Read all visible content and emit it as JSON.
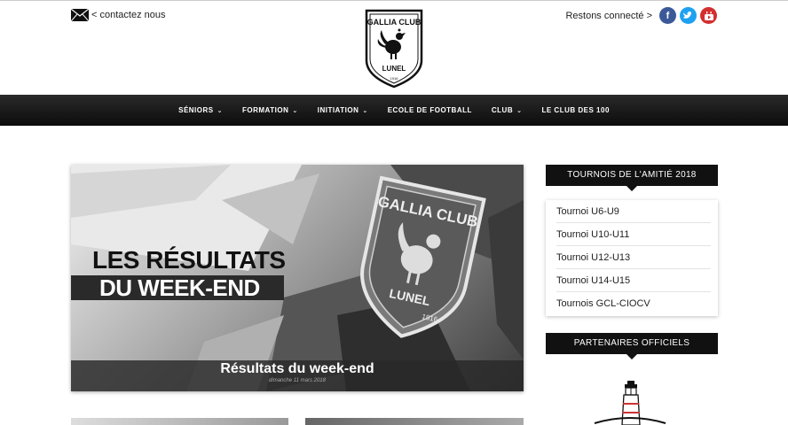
{
  "header": {
    "contact_label": "< contactez nous",
    "social_label": "Restons connecté >",
    "social": [
      {
        "name": "facebook",
        "glyph": "f",
        "color": "#3b5998"
      },
      {
        "name": "twitter",
        "glyph": "t",
        "color": "#1da1f2"
      },
      {
        "name": "youtube",
        "glyph": "▶",
        "color": "#d32f2f"
      }
    ],
    "logo": {
      "top_text": "GALLIA CLUB",
      "bottom_text": "LUNEL",
      "year": "1916"
    }
  },
  "nav": {
    "items": [
      {
        "label": "SÉNIORS",
        "has_dropdown": true
      },
      {
        "label": "FORMATION",
        "has_dropdown": true
      },
      {
        "label": "INITIATION",
        "has_dropdown": true
      },
      {
        "label": "ECOLE DE FOOTBALL",
        "has_dropdown": false
      },
      {
        "label": "CLUB",
        "has_dropdown": true
      },
      {
        "label": "LE CLUB DES 100",
        "has_dropdown": false
      }
    ]
  },
  "hero": {
    "image_line1": "LES RÉSULTATS",
    "image_line2": "DU WEEK-END",
    "badge_text": "GALLIA CLUB",
    "badge_bottom": "LUNEL",
    "badge_year": "1916",
    "title": "Résultats du week-end",
    "date": "dimanche 11 mars 2018"
  },
  "sidebar": {
    "tournois_title": "TOURNOIS DE L'AMITIÉ 2018",
    "tournois": [
      "Tournoi U6-U9",
      "Tournoi U10-U11",
      "Tournoi U12-U13",
      "Tournoi U14-U15",
      "Tournois GCL-CIOCV"
    ],
    "partners_title": "PARTENAIRES OFFICIELS"
  },
  "colors": {
    "nav_bg": "#111111",
    "widget_bg": "#111111",
    "accent": "#ffffff"
  }
}
